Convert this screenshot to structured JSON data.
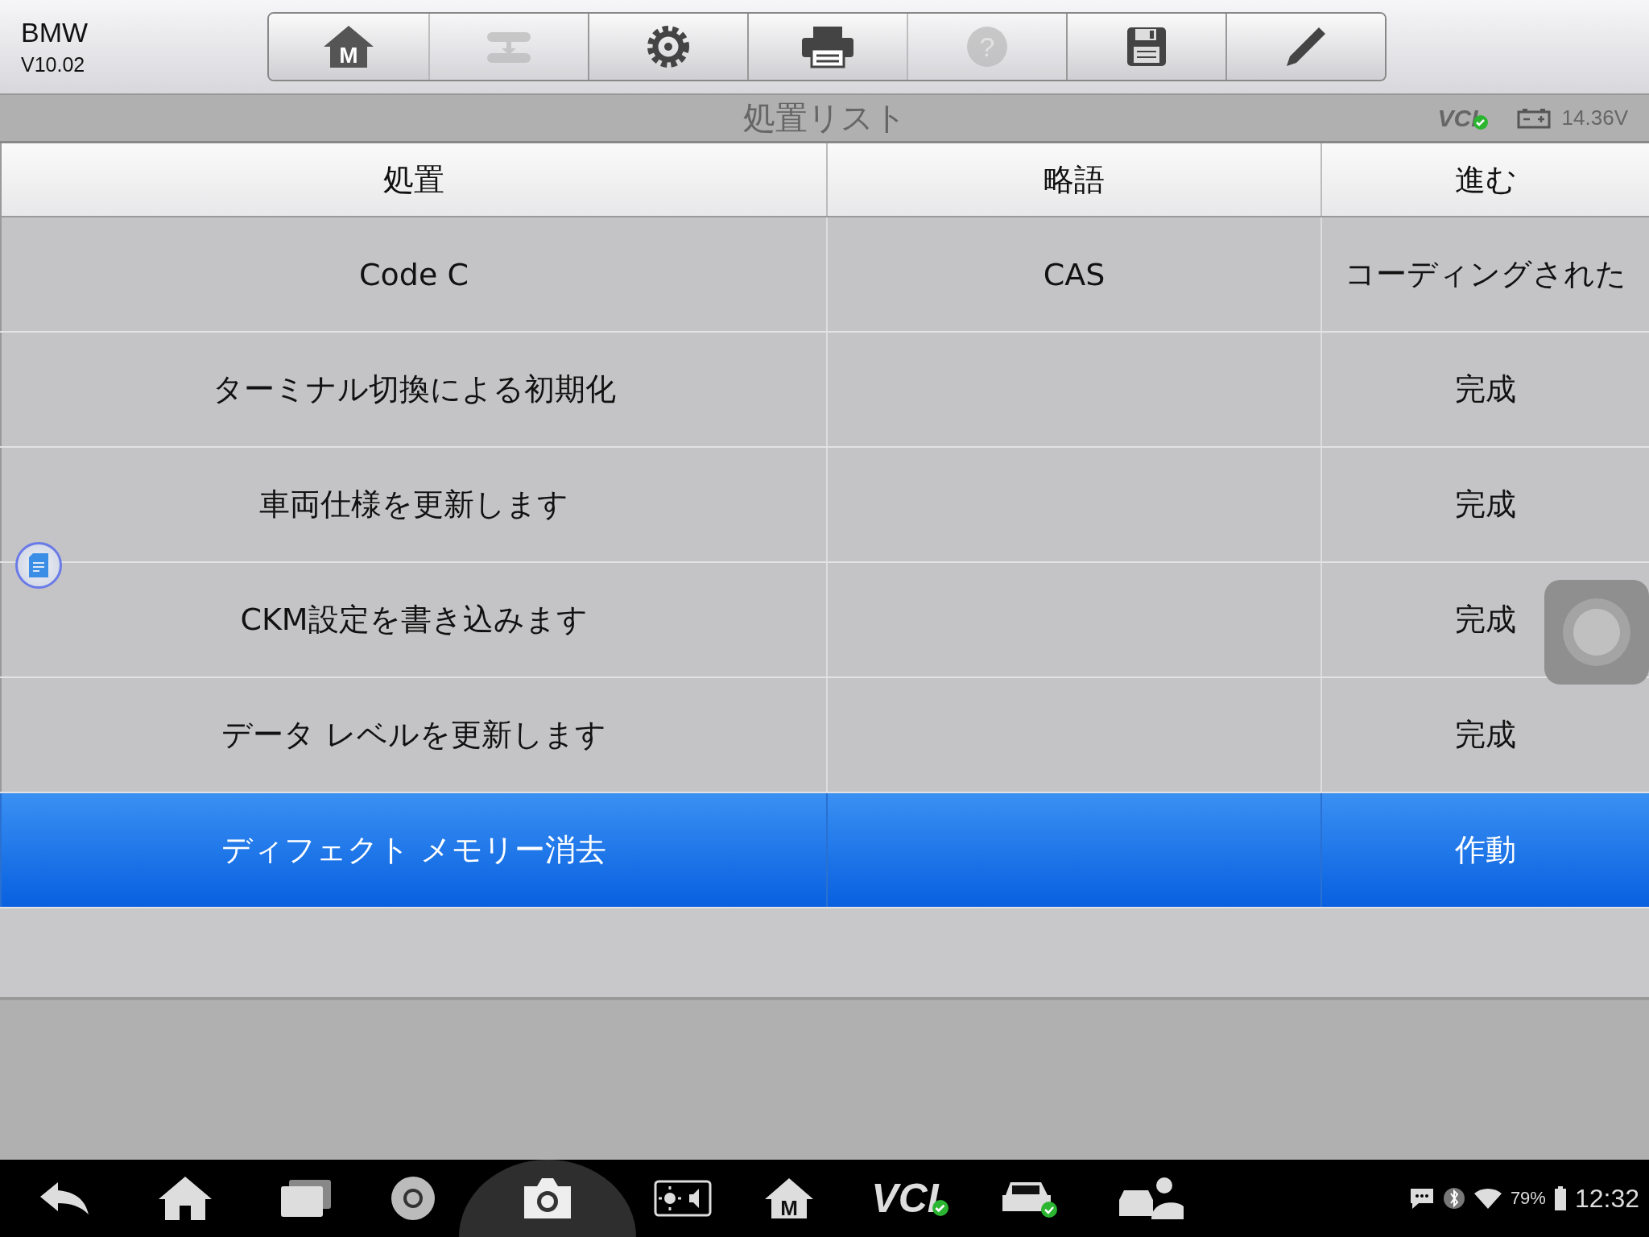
{
  "app": {
    "name": "BMW",
    "version": "V10.02"
  },
  "toolbar": [
    {
      "kind": "home",
      "disabled": false,
      "glyph": "M"
    },
    {
      "kind": "swap",
      "disabled": true
    },
    {
      "kind": "settings",
      "disabled": false
    },
    {
      "kind": "print",
      "disabled": false
    },
    {
      "kind": "help",
      "disabled": true,
      "glyph": "?"
    },
    {
      "kind": "save",
      "disabled": false
    },
    {
      "kind": "edit",
      "disabled": false
    }
  ],
  "title_bar": {
    "title": "処置リスト",
    "vci": "VCI",
    "voltage": "14.36V"
  },
  "table": {
    "columns": [
      "処置",
      "略語",
      "進む"
    ],
    "rows": [
      {
        "cells": [
          "Code C",
          "CAS",
          "コーディングされた"
        ],
        "selected": false
      },
      {
        "cells": [
          "ターミナル切換による初期化",
          "",
          "完成"
        ],
        "selected": false
      },
      {
        "cells": [
          "車両仕様を更新します",
          "",
          "完成"
        ],
        "selected": false
      },
      {
        "cells": [
          "CKM設定を書き込みます",
          "",
          "完成"
        ],
        "selected": false
      },
      {
        "cells": [
          "データ レベルを更新します",
          "",
          "完成"
        ],
        "selected": false
      },
      {
        "cells": [
          "ディフェクト メモリー消去",
          "",
          "作動"
        ],
        "selected": true
      }
    ]
  },
  "nav_bar": {
    "items": [
      {
        "kind": "back",
        "active": false
      },
      {
        "kind": "home",
        "active": false
      },
      {
        "kind": "recent",
        "active": false
      },
      {
        "kind": "browser",
        "active": false
      },
      {
        "kind": "camera",
        "active": true
      },
      {
        "kind": "display",
        "active": false
      },
      {
        "kind": "mhome",
        "active": false,
        "glyph": "M"
      },
      {
        "kind": "vci",
        "active": false,
        "label": "VCI"
      },
      {
        "kind": "car",
        "active": false
      },
      {
        "kind": "service",
        "active": false
      }
    ],
    "battery": "79%",
    "time": "12:32"
  }
}
